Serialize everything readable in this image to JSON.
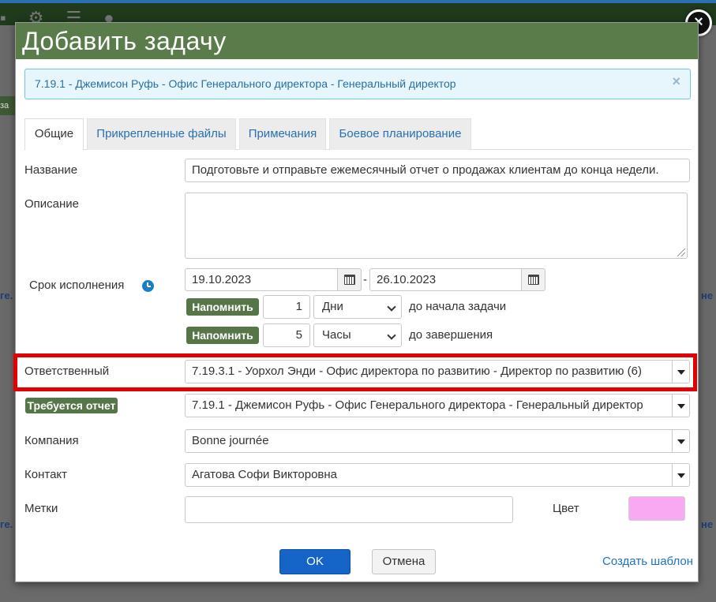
{
  "dialog": {
    "title": "Добавить задачу",
    "close_icon": "×",
    "alert_text": "7.19.1 - Джемисон Руфь - Офис Генерального директора - Генеральный директор",
    "alert_close": "×"
  },
  "tabs": [
    {
      "label": "Общие",
      "active": true
    },
    {
      "label": "Прикрепленные файлы",
      "active": false
    },
    {
      "label": "Примечания",
      "active": false
    },
    {
      "label": "Боевое планирование",
      "active": false
    }
  ],
  "form": {
    "name_label": "Название",
    "name_value": "Подготовьте и отправьте ежемесячный отчет о продажах клиентам до конца недели.",
    "description_label": "Описание",
    "description_value": "",
    "deadline_label": "Срок исполнения",
    "date_start": "19.10.2023",
    "date_separator": "-",
    "date_end": "26.10.2023",
    "reminders": [
      {
        "button": "Напомнить",
        "amount": "1",
        "unit": "Дни",
        "suffix": "до начала задачи"
      },
      {
        "button": "Напомнить",
        "amount": "5",
        "unit": "Часы",
        "suffix": "до завершения"
      }
    ],
    "responsible_label": "Ответственный",
    "responsible_value": "7.19.3.1 - Уорхол Энди - Офис директора по развитию - Директор по развитию (6)",
    "report_badge": "Требуется отчет",
    "report_value": "7.19.1 - Джемисон Руфь - Офис Генерального директора - Генеральный директор",
    "company_label": "Компания",
    "company_value": "Bonne journée",
    "contact_label": "Контакт",
    "contact_value": "Агатова Софи Викторовна",
    "tags_label": "Метки",
    "tags_value": "",
    "color_label": "Цвет",
    "color_value": "#f9a8f2"
  },
  "footer": {
    "ok_label": "OK",
    "cancel_label": "Отмена",
    "template_link": "Создать шаблон"
  },
  "colors": {
    "header": "#5a7b4a",
    "badge": "#56764a",
    "primary": "#1565c9",
    "highlight": "#e40000"
  }
}
